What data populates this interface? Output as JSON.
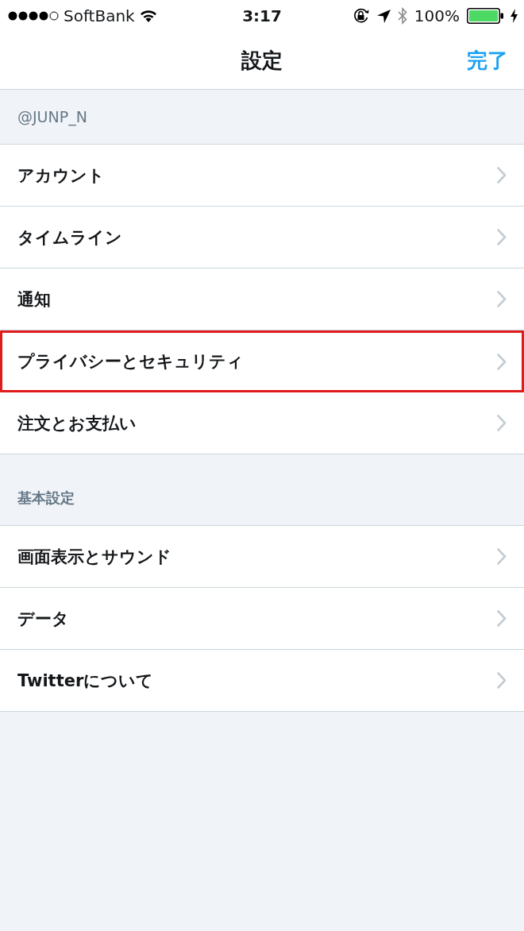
{
  "status_bar": {
    "carrier": "SoftBank",
    "time": "3:17",
    "battery": "100%"
  },
  "nav_bar": {
    "title": "設定",
    "done_button": "完了"
  },
  "sections": [
    {
      "header": "@JUNP_N",
      "items": [
        {
          "label": "アカウント",
          "highlighted": false
        },
        {
          "label": "タイムライン",
          "highlighted": false
        },
        {
          "label": "通知",
          "highlighted": false
        },
        {
          "label": "プライバシーとセキュリティ",
          "highlighted": true
        },
        {
          "label": "注文とお支払い",
          "highlighted": false
        }
      ]
    },
    {
      "header": "基本設定",
      "items": [
        {
          "label": "画面表示とサウンド",
          "highlighted": false
        },
        {
          "label": "データ",
          "highlighted": false
        },
        {
          "label": "Twitterについて",
          "highlighted": false
        }
      ]
    }
  ]
}
